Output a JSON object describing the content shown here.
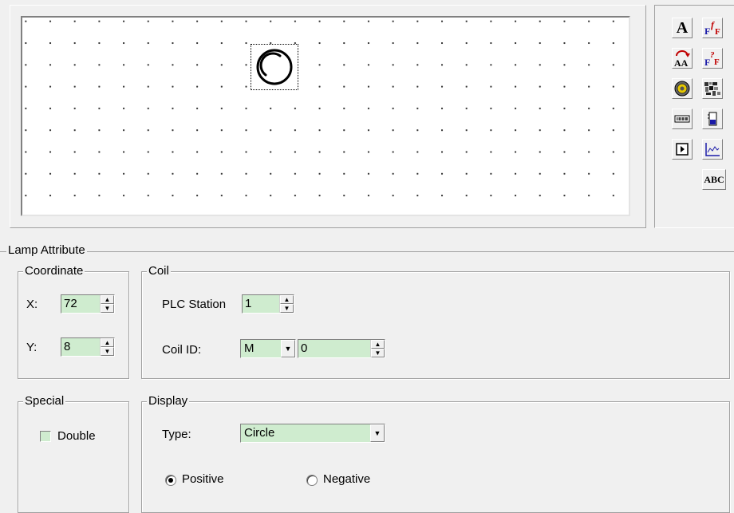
{
  "toolbox": {
    "tools": [
      {
        "name": "static-text-tool",
        "glyph": "A"
      },
      {
        "name": "text-font-tool",
        "glyph": "F"
      },
      {
        "name": "multi-state-text-tool",
        "glyph": "AA"
      },
      {
        "name": "dynamic-font-tool",
        "glyph": "F"
      },
      {
        "name": "lamp-tool",
        "glyph": ""
      },
      {
        "name": "bitmap-tool",
        "glyph": ""
      },
      {
        "name": "numeric-display-tool",
        "glyph": ""
      },
      {
        "name": "bar-graph-tool",
        "glyph": ""
      },
      {
        "name": "button-tool",
        "glyph": ""
      },
      {
        "name": "trend-graph-tool",
        "glyph": ""
      },
      {
        "name": "ascii-tool",
        "glyph": "ABC"
      }
    ]
  },
  "lamp_attribute": {
    "title": "Lamp Attribute",
    "coordinate": {
      "title": "Coordinate",
      "x_label": "X:",
      "x_value": "72",
      "y_label": "Y:",
      "y_value": "8"
    },
    "coil": {
      "title": "Coil",
      "plc_station_label": "PLC Station",
      "plc_station_value": "1",
      "coil_id_label": "Coil ID:",
      "coil_type": "M",
      "coil_number": "0"
    },
    "special": {
      "title": "Special",
      "double_label": "Double",
      "double_checked": false
    },
    "display": {
      "title": "Display",
      "type_label": "Type:",
      "type_value": "Circle",
      "positive_label": "Positive",
      "negative_label": "Negative",
      "selected": "Positive"
    }
  },
  "colors": {
    "field_background": "#cfeccf",
    "window_background": "#f0f0f0"
  }
}
